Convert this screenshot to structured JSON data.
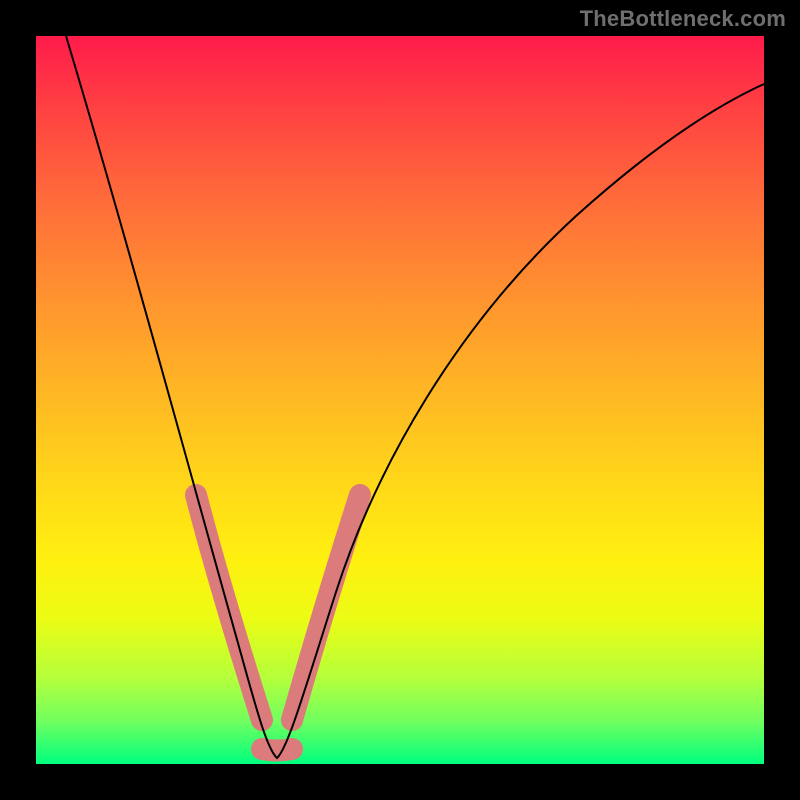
{
  "watermark": "TheBottleneck.com",
  "chart_data": {
    "type": "line",
    "title": "",
    "xlabel": "",
    "ylabel": "",
    "xlim": [
      0,
      100
    ],
    "ylim": [
      0,
      100
    ],
    "series": [
      {
        "name": "bottleneck-curve",
        "x": [
          4,
          8,
          12,
          16,
          20,
          24,
          27,
          29,
          31,
          33,
          35,
          38,
          42,
          48,
          56,
          66,
          78,
          90,
          100
        ],
        "y": [
          100,
          86,
          72,
          58,
          44,
          30,
          18,
          10,
          4,
          0,
          4,
          10,
          18,
          28,
          40,
          52,
          62,
          70,
          76
        ]
      }
    ],
    "highlighted_segments": [
      {
        "name": "left-band",
        "x": [
          22.0,
          31.0
        ],
        "y": [
          37,
          6
        ]
      },
      {
        "name": "bottom-band",
        "x": [
          31.0,
          35.0
        ],
        "y": [
          2,
          2
        ]
      },
      {
        "name": "right-band",
        "x": [
          35.0,
          44.5
        ],
        "y": [
          6,
          37
        ]
      }
    ],
    "background_gradient": {
      "top": "#ff1b4b",
      "bottom": "#00ff7f"
    }
  }
}
